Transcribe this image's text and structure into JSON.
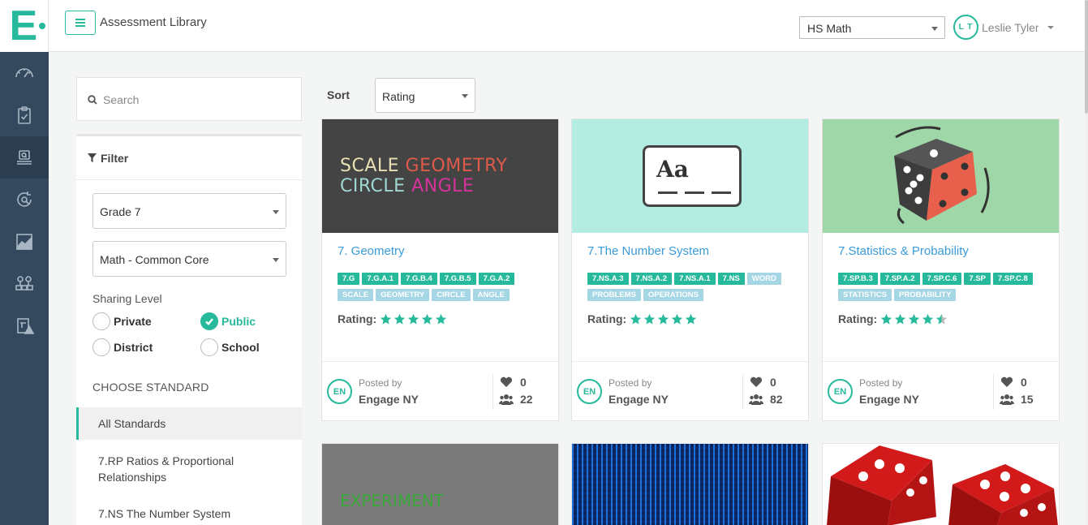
{
  "app": {
    "logo_letter": "E",
    "title": "Assessment Library",
    "subject_select": "HS Math",
    "user_initials": "L T",
    "user_name": "Leslie Tyler"
  },
  "nav": [
    {
      "name": "dashboard-icon"
    },
    {
      "name": "clipboard-icon"
    },
    {
      "name": "assessment-library-icon",
      "active": true
    },
    {
      "name": "search-refresh-icon"
    },
    {
      "name": "chart-icon"
    },
    {
      "name": "network-icon"
    },
    {
      "name": "alert-report-icon"
    }
  ],
  "search": {
    "placeholder": "Search"
  },
  "filter": {
    "heading": "Filter",
    "grade": "Grade 7",
    "curriculum": "Math - Common Core",
    "sharing_level_label": "Sharing Level",
    "sharing_options": [
      {
        "label": "Private",
        "checked": false
      },
      {
        "label": "Public",
        "checked": true
      },
      {
        "label": "District",
        "checked": false
      },
      {
        "label": "School",
        "checked": false
      }
    ],
    "choose_standard_label": "CHOOSE STANDARD",
    "standards": [
      "All Standards",
      "7.RP Ratios & Proportional Relationships",
      "7.NS The Number System"
    ]
  },
  "sort": {
    "label": "Sort",
    "value": "Rating"
  },
  "colors": {
    "accent": "#27b99c",
    "link": "#3a9bd8",
    "rail": "#34495e"
  },
  "cards": [
    {
      "title": "7. Geometry",
      "thumb_words": [
        "SCALE",
        "GEOMETRY",
        "CIRCLE",
        "ANGLE"
      ],
      "std_tags": [
        "7.G",
        "7.G.A.1",
        "7.G.B.4",
        "7.G.B.5",
        "7.G.A.2"
      ],
      "kw_tags": [
        "SCALE",
        "GEOMETRY",
        "CIRCLE",
        "ANGLE"
      ],
      "rating_label": "Rating:",
      "rating": 5,
      "badge": "EN",
      "posted_by_label": "Posted by",
      "poster": "Engage NY",
      "likes": "0",
      "users": "22"
    },
    {
      "title": "7.The Number System",
      "thumb_text": "Aa",
      "std_tags": [
        "7.NS.A.3",
        "7.NS.A.2",
        "7.NS.A.1",
        "7.NS"
      ],
      "kw_tags": [
        "WORD",
        "PROBLEMS",
        "OPERATIONS"
      ],
      "rating_label": "Rating:",
      "rating": 5,
      "badge": "EN",
      "posted_by_label": "Posted by",
      "poster": "Engage NY",
      "likes": "0",
      "users": "82"
    },
    {
      "title": "7.Statistics & Probability",
      "std_tags": [
        "7.SP.B.3",
        "7.SP.A.2",
        "7.SP.C.6",
        "7.SP",
        "7.SP.C.8"
      ],
      "kw_tags": [
        "STATISTICS",
        "PROBABILITY"
      ],
      "rating_label": "Rating:",
      "rating": 4.5,
      "badge": "EN",
      "posted_by_label": "Posted by",
      "poster": "Engage NY",
      "likes": "0",
      "users": "15"
    }
  ],
  "next_row": {
    "experiment_text": "EXPERIMENT"
  }
}
